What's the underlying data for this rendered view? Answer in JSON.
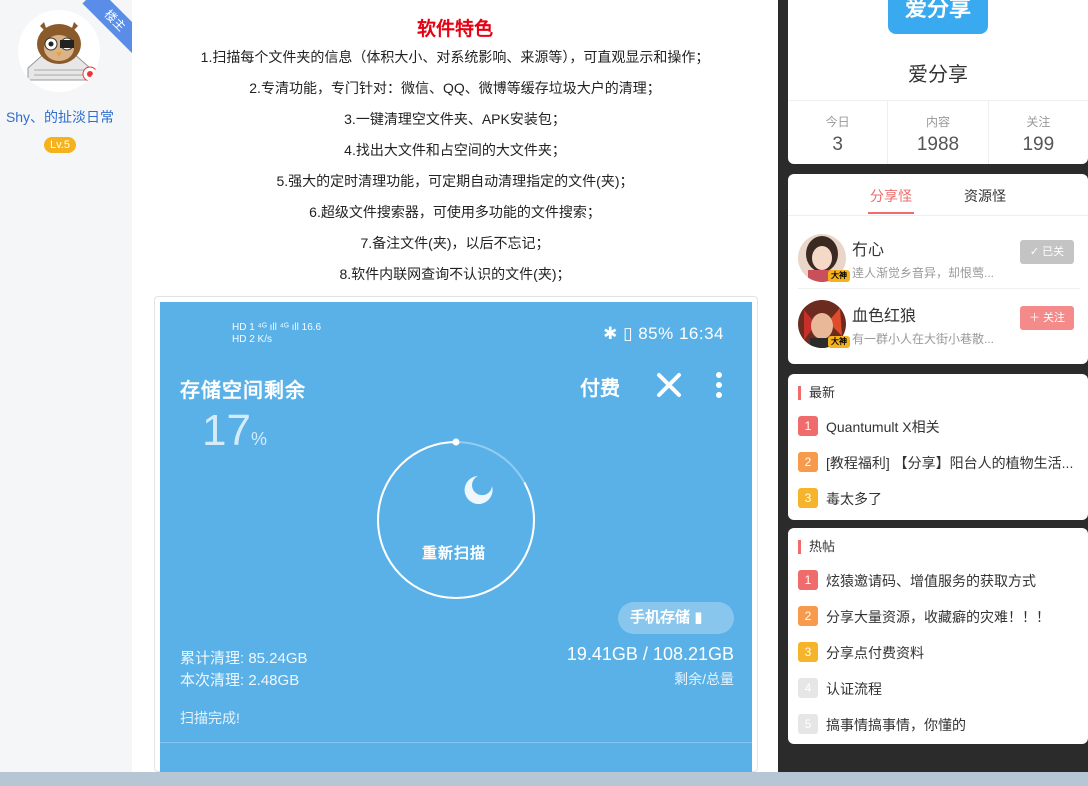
{
  "author": {
    "owner_badge": "楼主",
    "name": "Shy、的扯淡日常",
    "level": "Lv.5"
  },
  "article": {
    "feature_title": "软件特色",
    "features": [
      "1.扫描每个文件夹的信息（体积大小、对系统影响、来源等），可直观显示和操作；",
      "2.专清功能，专门针对：微信、QQ、微博等缓存垃圾大户的清理；",
      "3.一键清理空文件夹、APK安装包；",
      "4.找出大文件和占空间的大文件夹；",
      "5.强大的定时清理功能，可定期自动清理指定的文件(夹)；",
      "6.超级文件搜索器，可使用多功能的文件搜索；",
      "7.备注文件(夹)，以后不忘记；",
      "8.软件内联网查询不认识的文件(夹)；"
    ],
    "screenshot": {
      "sb_left_line1": "HD 1 ⁴ᴳ ıll ⁴ᴳ ıll 16.6",
      "sb_left_line2": "HD 2 K/s",
      "status_right": "85%  16:34",
      "title": "存储空间剩余",
      "pay_label": "付费",
      "percent": "17",
      "percent_unit": "%",
      "progress_fraction": 0.17,
      "rescan_label": "重新扫描",
      "storage_button": "手机存储",
      "total_cleaned": "累计清理: 85.24GB",
      "this_cleaned": "本次清理: 2.48GB",
      "capacity": "19.41GB / 108.21GB",
      "capacity_label": "剩余/总量",
      "scan_status": "扫描完成!"
    }
  },
  "site": {
    "logo_text": "爱分享",
    "name": "爱分享",
    "stats": [
      {
        "label": "今日",
        "value": "3"
      },
      {
        "label": "内容",
        "value": "1988"
      },
      {
        "label": "关注",
        "value": "199"
      }
    ]
  },
  "users": {
    "tabs": [
      "分享怪",
      "资源怪"
    ],
    "active_tab": "分享怪",
    "list": [
      {
        "name": "冇心",
        "desc": "逹人渐觉乡音异，却恨莺...",
        "badge": "大神",
        "button": "已关",
        "followed": true
      },
      {
        "name": "血色红狼",
        "desc": "有一群小人在大街小巷散...",
        "badge": "大神",
        "button": "关注",
        "followed": false
      }
    ]
  },
  "latest": {
    "heading": "最新",
    "items": [
      {
        "rank": "1",
        "title": "Quantumult X相关"
      },
      {
        "rank": "2",
        "title": "[教程福利] 【分享】阳台人的植物生活..."
      },
      {
        "rank": "3",
        "title": "毒太多了"
      }
    ]
  },
  "hot": {
    "heading": "热帖",
    "items": [
      {
        "rank": "1",
        "title": "炫猿邀请码、增值服务的获取方式"
      },
      {
        "rank": "2",
        "title": "分享大量资源，收藏癖的灾难！！！"
      },
      {
        "rank": "3",
        "title": "分享点付费资料"
      },
      {
        "rank": "4",
        "title": "认证流程"
      },
      {
        "rank": "5",
        "title": "搞事情搞事情，你懂的"
      }
    ]
  },
  "colors": {
    "accent_red": "#e60012",
    "link_blue": "#2f6ed1",
    "screenshot_bg": "#5ab1e8",
    "rank_red": "#f06b6b",
    "rank_orange": "#f79a4c",
    "rank_yellow": "#f5b42c"
  }
}
